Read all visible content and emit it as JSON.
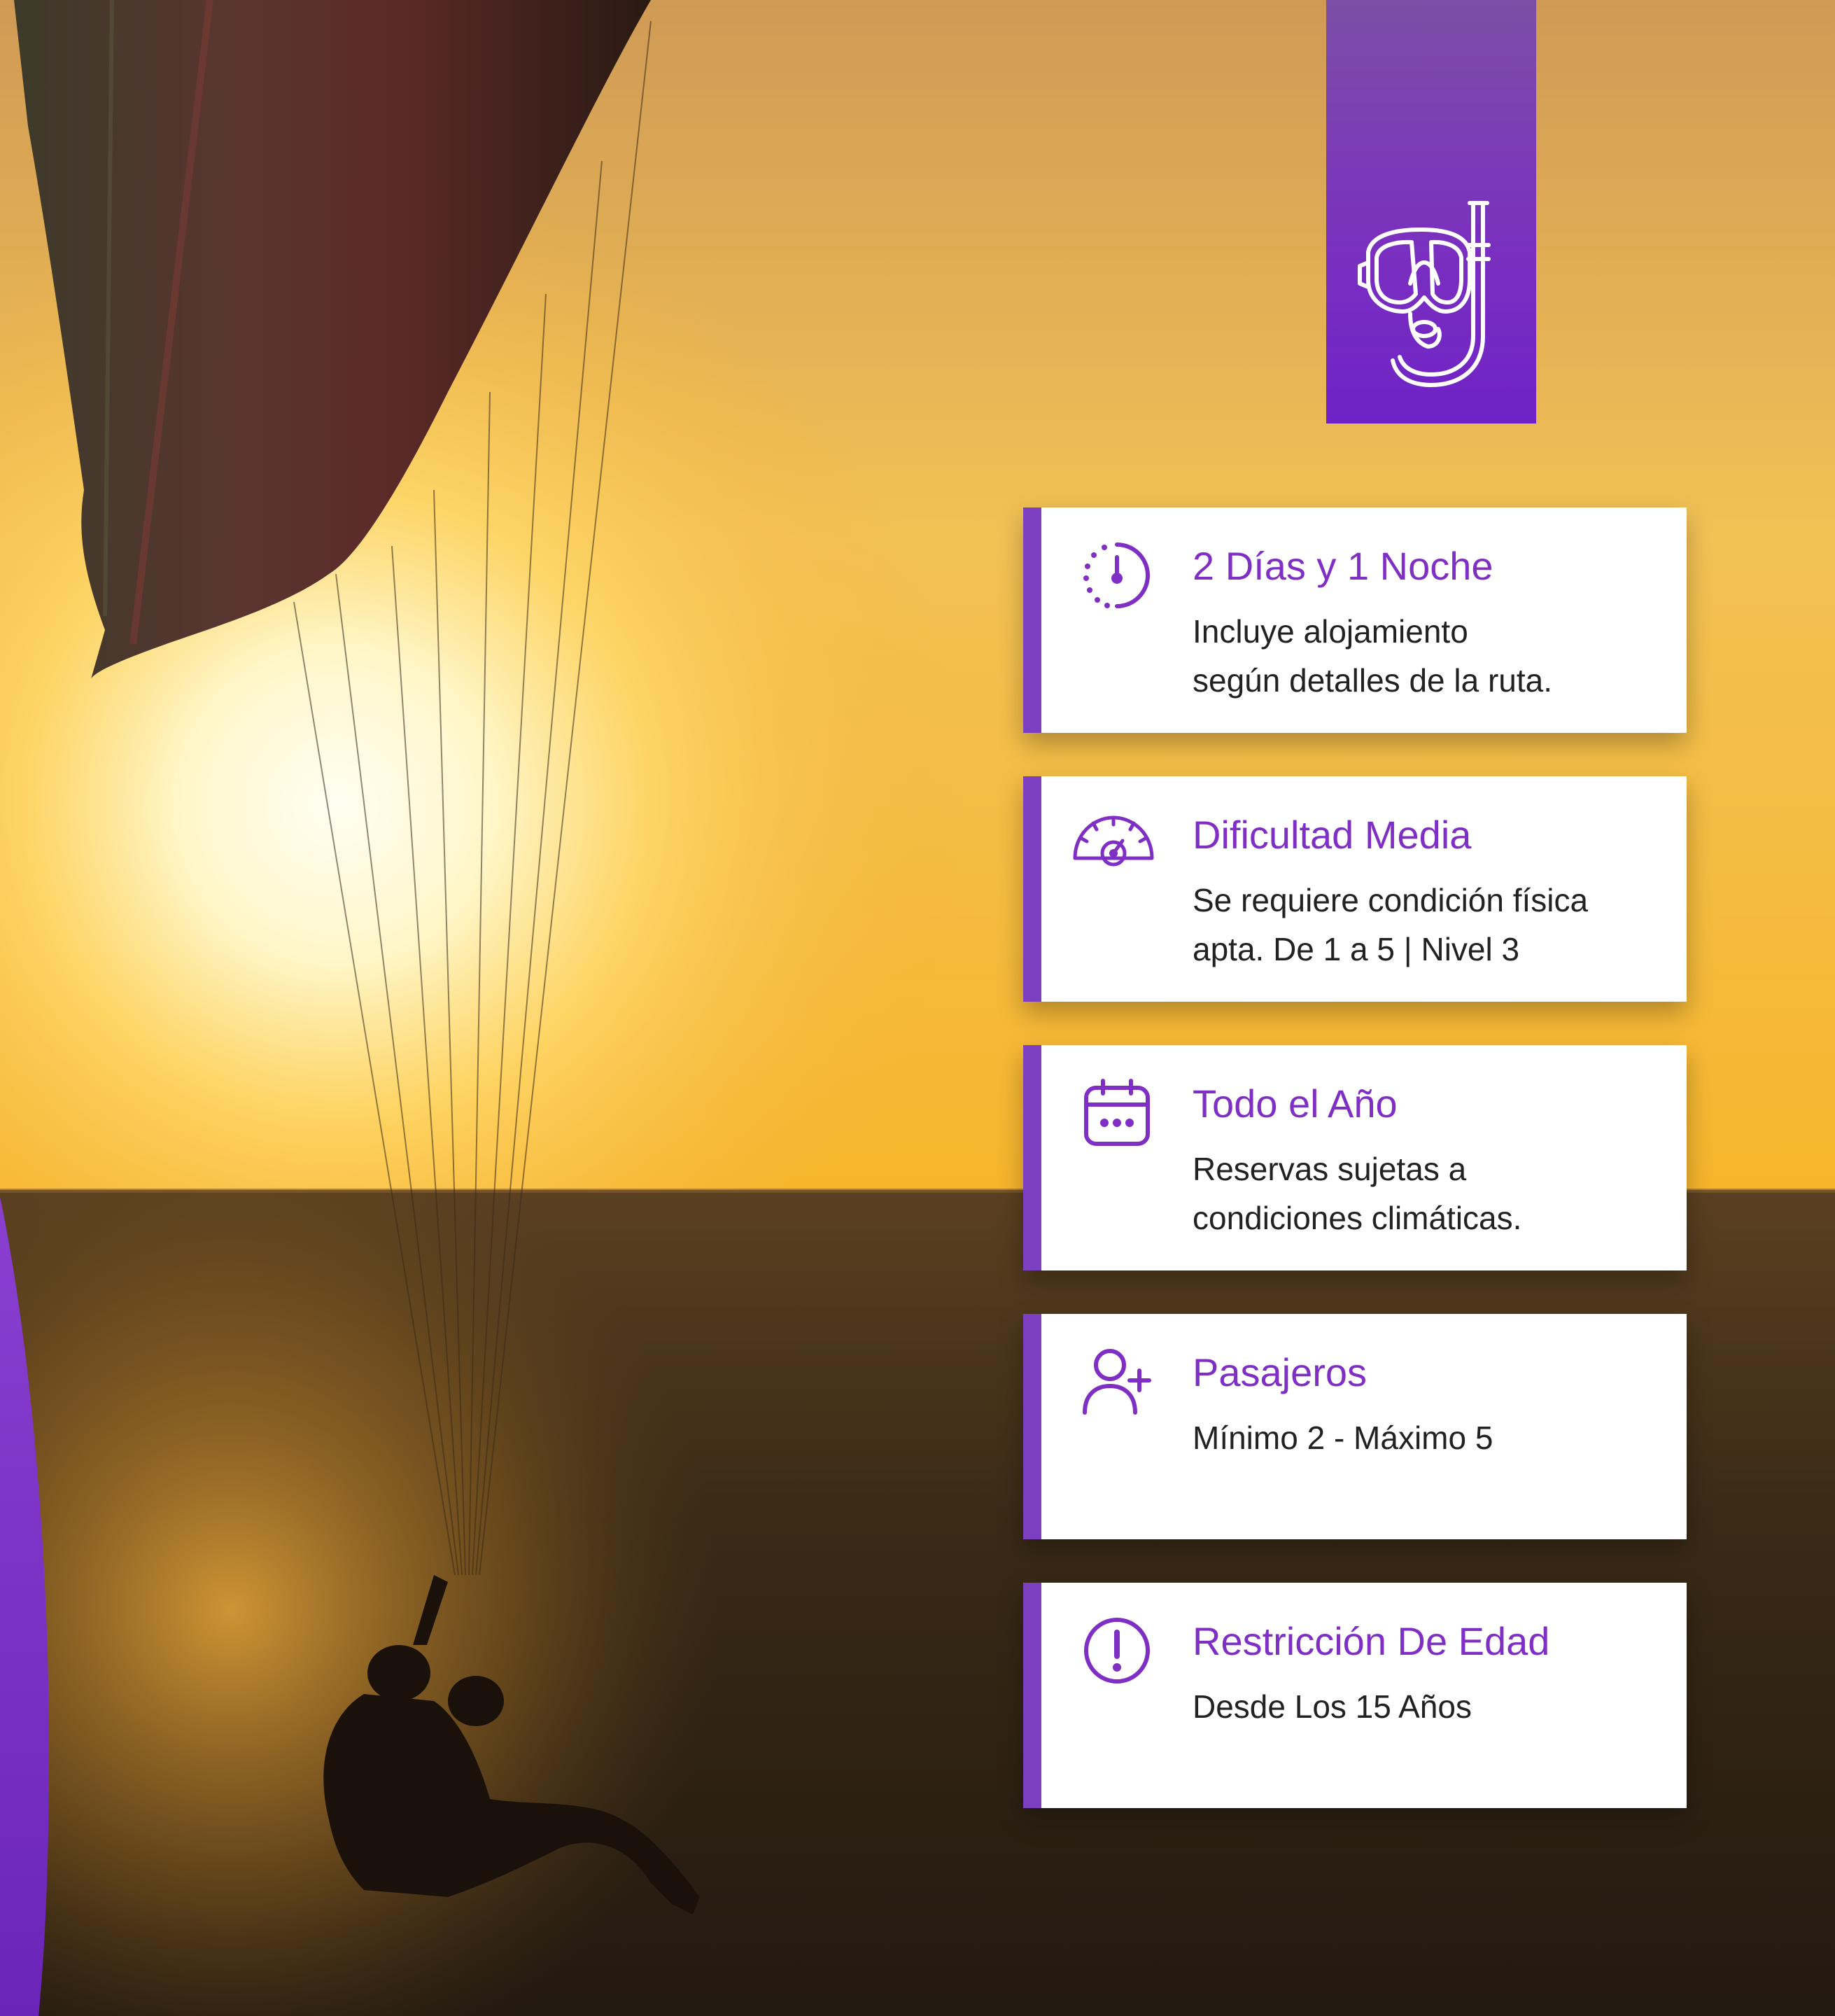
{
  "colors": {
    "accent": "#7f2fc4",
    "accent_bar": "#7b3fbf",
    "card_bg": "#ffffff",
    "text": "#222222",
    "sky_top": "#d9a560",
    "sun": "#fffde8",
    "sea": "#2e2214"
  },
  "badge": {
    "icon": "snorkel-mask-icon"
  },
  "features": [
    {
      "icon": "clock-icon",
      "title": "2 Días y 1 Noche",
      "lines": [
        "Incluye alojamiento",
        "según detalles de la ruta."
      ]
    },
    {
      "icon": "speedometer-icon",
      "title": "Dificultad Media",
      "lines": [
        "Se requiere condición física",
        "apta. De 1 a 5 | Nivel 3"
      ]
    },
    {
      "icon": "calendar-icon",
      "title": "Todo el Año",
      "lines": [
        "Reservas sujetas a",
        "condiciones climáticas."
      ]
    },
    {
      "icon": "add-user-icon",
      "title": "Pasajeros",
      "lines": [
        "Mínimo 2 - Máximo 5"
      ]
    },
    {
      "icon": "alert-circle-icon",
      "title": "Restricción De Edad",
      "lines": [
        "Desde Los 15 Años"
      ]
    }
  ]
}
